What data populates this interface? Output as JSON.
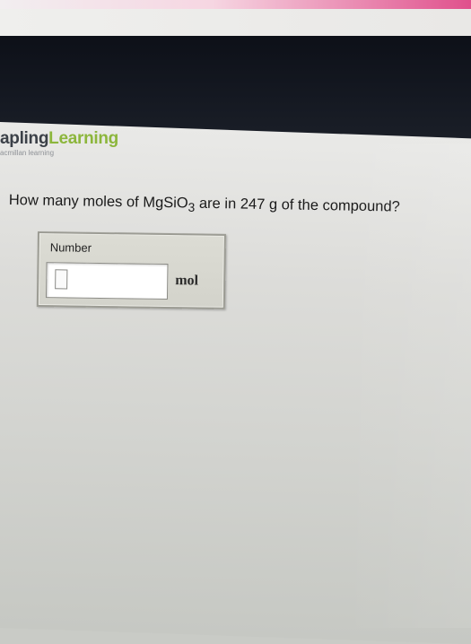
{
  "brand": {
    "name_part1": "apling",
    "name_part2": "Learning",
    "subtitle": "acmillan learning",
    "color_dark": "#3c4148",
    "color_green": "#8cb63c"
  },
  "question": {
    "prefix": "How many moles of MgSiO",
    "subscript": "3",
    "suffix": " are in 247 g of the compound?"
  },
  "answer": {
    "label": "Number",
    "value": "",
    "unit": "mol"
  }
}
